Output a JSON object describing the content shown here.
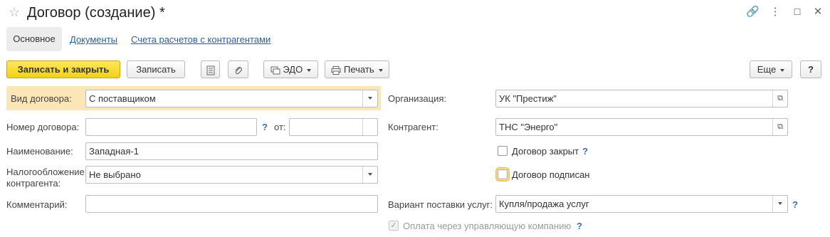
{
  "window": {
    "title": "Договор (создание) *",
    "star_icon": "star-icon",
    "controls": [
      "link-icon",
      "more-icon",
      "restore-icon",
      "close-icon"
    ]
  },
  "tabs": [
    {
      "label": "Основное",
      "active": true
    },
    {
      "label": "Документы",
      "active": false
    },
    {
      "label": "Счета расчетов с контрагентами",
      "active": false
    }
  ],
  "toolbar": {
    "save_close": "Записать и закрыть",
    "save": "Записать",
    "edo": "ЭДО",
    "print": "Печать",
    "more": "Еще",
    "help": "?"
  },
  "form": {
    "contract_type": {
      "label": "Вид договора:",
      "value": "С поставщиком"
    },
    "contract_number": {
      "label": "Номер договора:",
      "value": "",
      "date_label": "от:",
      "date_value": " .  .    "
    },
    "name": {
      "label": "Наименование:",
      "value": "Западная-1"
    },
    "taxation": {
      "label_line1": "Налогообложение",
      "label_line2": "контрагента:",
      "value": "Не выбрано"
    },
    "comment": {
      "label": "Комментарий:",
      "value": ""
    },
    "organization": {
      "label": "Организация:",
      "value": "УК \"Престиж\""
    },
    "counterparty": {
      "label": "Контрагент:",
      "value": "ТНС \"Энерго\""
    },
    "closed": {
      "label": "Договор закрыт",
      "checked": false
    },
    "signed": {
      "label": "Договор подписан",
      "checked": false
    },
    "service_variant": {
      "label": "Вариант поставки услуг:",
      "value": "Купля/продажа услуг"
    },
    "pay_via_mc": {
      "label": "Оплата через управляющую компанию",
      "checked": true,
      "disabled": true
    }
  },
  "help_mark": "?",
  "colors": {
    "primary_button": "#f5d016",
    "highlight": "#fbe6b8",
    "link": "#2a5e9c",
    "help": "#3a6fb5"
  }
}
